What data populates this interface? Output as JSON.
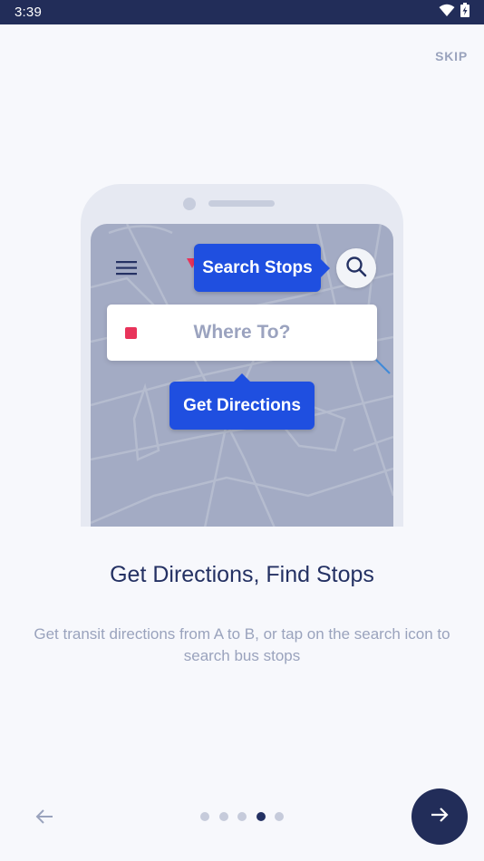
{
  "status_bar": {
    "time": "3:39"
  },
  "header": {
    "skip_label": "SKIP"
  },
  "illustration": {
    "search_tooltip": "Search Stops",
    "where_placeholder": "Where To?",
    "directions_tooltip": "Get Directions"
  },
  "content": {
    "heading": "Get Directions, Find Stops",
    "description": "Get transit directions from A to B, or tap on the search icon to search bus stops"
  },
  "pagination": {
    "total_pages": 5,
    "current_page": 4
  },
  "colors": {
    "status_bar": "#222d59",
    "accent_blue": "#1f4fe0",
    "next_button": "#222d59",
    "destination_marker": "#e8335a"
  },
  "icons": {
    "status": [
      "wifi-icon",
      "battery-icon"
    ],
    "illustration": [
      "menu-icon",
      "search-icon"
    ],
    "navigation": [
      "arrow-left-icon",
      "arrow-right-icon"
    ]
  }
}
